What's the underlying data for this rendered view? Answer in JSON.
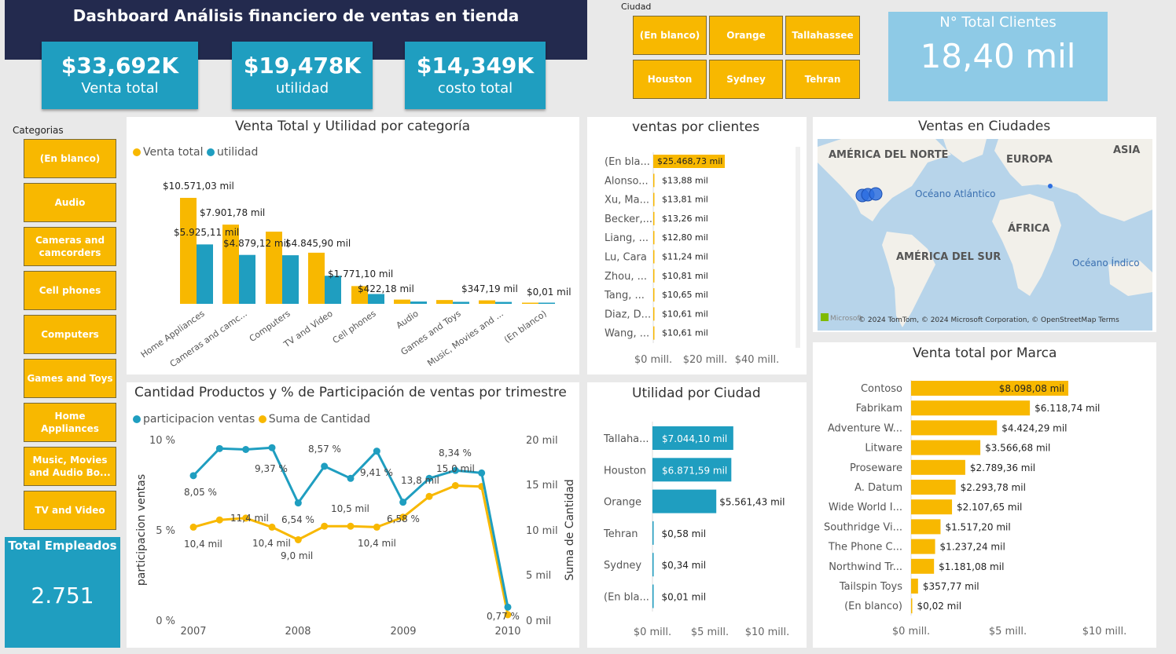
{
  "header": {
    "title": "Dashboard Análisis financiero de ventas en tienda"
  },
  "kpis": [
    {
      "value": "$33,692K",
      "label": "Venta total"
    },
    {
      "value": "$19,478K",
      "label": "utilidad"
    },
    {
      "value": "$14,349K",
      "label": "costo total"
    }
  ],
  "city_slicer": {
    "label": "Ciudad",
    "options": [
      "(En blanco)",
      "Orange",
      "Tallahassee",
      "Houston",
      "Sydney",
      "Tehran"
    ]
  },
  "total_clients": {
    "label": "N° Total Clientes",
    "value": "18,40 mil"
  },
  "category_slicer": {
    "label": "Categorias",
    "options": [
      "(En blanco)",
      "Audio",
      "Cameras and camcorders",
      "Cell phones",
      "Computers",
      "Games and Toys",
      "Home Appliances",
      "Music, Movies and Audio Bo...",
      "TV and Video"
    ]
  },
  "total_employees": {
    "label": "Total Empleados",
    "value": "2.751"
  },
  "colors": {
    "navy": "#232a4e",
    "teal": "#1f9ec0",
    "gold": "#f8b800",
    "light_blue": "#8ecae6"
  },
  "map": {
    "title": "Ventas en Ciudades",
    "labels": [
      "AMÉRICA DEL NORTE",
      "EUROPA",
      "ASIA",
      "Océano Atlántico",
      "ÁFRICA",
      "AMÉRICA DEL SUR",
      "Océano Índico"
    ],
    "attribution": "© 2024 TomTom, © 2024 Microsoft Corporation, © OpenStreetMap Terms",
    "brand": "Microsoft"
  },
  "chart_data": [
    {
      "type": "bar",
      "title": "Venta Total y Utilidad por categoría",
      "categories": [
        "Home Appliances",
        "Cameras and camc...",
        "Computers",
        "TV and Video",
        "Cell phones",
        "Audio",
        "Games and Toys",
        "Music, Movies and ...",
        "(En blanco)"
      ],
      "series": [
        {
          "name": "Venta total",
          "values": [
            10571.03,
            7901.78,
            7200,
            5100,
            1771.1,
            422.18,
            380,
            347.19,
            0.01
          ]
        },
        {
          "name": "utilidad",
          "values": [
            5925.11,
            4879.12,
            4845.9,
            2800,
            980,
            230,
            200,
            190,
            0.01
          ]
        }
      ],
      "data_labels": [
        "$10.571,03 mil",
        "$7.901,78 mil",
        "$5.925,11 mil",
        "$4.879,12 mil",
        "$4.845,90 mil",
        "$1.771,10 mil",
        "$422,18 mil",
        "$347,19 mil",
        "$0,01 mil"
      ]
    },
    {
      "type": "bar",
      "title": "ventas por clientes",
      "categories": [
        "(En bla...",
        "Alonso...",
        "Xu, Ma...",
        "Becker,...",
        "Liang, ...",
        "Lu, Cara",
        "Zhou, ...",
        "Tang, ...",
        "Diaz, D...",
        "Wang, ..."
      ],
      "values": [
        25468.73,
        13.88,
        13.81,
        13.26,
        12.8,
        11.24,
        10.81,
        10.65,
        10.61,
        10.61
      ],
      "labels": [
        "$25.468,73 mil",
        "$13,88 mil",
        "$13,81 mil",
        "$13,26 mil",
        "$12,80 mil",
        "$11,24 mil",
        "$10,81 mil",
        "$10,65 mil",
        "$10,61 mil",
        "$10,61 mil"
      ],
      "xticks": [
        "$0 mill.",
        "$20 mill.",
        "$40 mill."
      ]
    },
    {
      "type": "line",
      "title": "Cantidad Productos y % de Participación de ventas por trimestre",
      "legend": [
        "participacion ventas",
        "Suma de Cantidad"
      ],
      "x_ticks": [
        "2007",
        "2008",
        "2009",
        "2010"
      ],
      "y_left_ticks": [
        "10 %",
        "5 %",
        "0 %"
      ],
      "y_right_ticks": [
        "20 mil",
        "15 mil",
        "10 mil",
        "5 mil",
        "0 mil"
      ],
      "ylabel_left": "participacion ventas",
      "ylabel_right": "Suma de Cantidad",
      "series": [
        {
          "name": "participacion ventas",
          "values": [
            8.05,
            9.55,
            9.5,
            9.6,
            6.54,
            8.57,
            7.9,
            9.41,
            6.58,
            7.9,
            8.34,
            8.2,
            0.77
          ]
        },
        {
          "name": "Suma de Cantidad",
          "values": [
            10.4,
            11.2,
            11.4,
            10.4,
            9.0,
            10.5,
            10.5,
            10.4,
            11.5,
            13.8,
            15.0,
            14.9,
            0.7
          ]
        }
      ],
      "point_labels": [
        "8,05 %",
        "9,37 %",
        "6,54 %",
        "8,57 %",
        "9,41 %",
        "6,58 %",
        "8,34 %",
        "0,77 %",
        "10,4 mil",
        "11,4 mil",
        "10,4 mil",
        "9,0 mil",
        "10,5 mil",
        "10,4 mil",
        "13,8 mil",
        "15,0 mil"
      ]
    },
    {
      "type": "bar",
      "title": "Utilidad por Ciudad",
      "categories": [
        "Tallaha...",
        "Houston",
        "Orange",
        "Tehran",
        "Sydney",
        "(En bla..."
      ],
      "values": [
        7044.1,
        6871.59,
        5561.43,
        0.58,
        0.34,
        0.01
      ],
      "labels": [
        "$7.044,10 mil",
        "$6.871,59 mil",
        "$5.561,43 mil",
        "$0,58 mil",
        "$0,34 mil",
        "$0,01 mil"
      ],
      "xticks": [
        "$0 mill.",
        "$5 mill.",
        "$10 mill."
      ]
    },
    {
      "type": "bar",
      "title": "Venta total por Marca",
      "categories": [
        "Contoso",
        "Fabrikam",
        "Adventure W...",
        "Litware",
        "Proseware",
        "A. Datum",
        "Wide World I...",
        "Southridge Vi...",
        "The Phone C...",
        "Northwind Tr...",
        "Tailspin Toys",
        "(En blanco)"
      ],
      "values": [
        8098.08,
        6118.74,
        4424.29,
        3566.68,
        2789.36,
        2293.78,
        2107.65,
        1517.2,
        1237.24,
        1181.08,
        357.77,
        0.02
      ],
      "labels": [
        "$8.098,08 mil",
        "$6.118,74 mil",
        "$4.424,29 mil",
        "$3.566,68 mil",
        "$2.789,36 mil",
        "$2.293,78 mil",
        "$2.107,65 mil",
        "$1.517,20 mil",
        "$1.237,24 mil",
        "$1.181,08 mil",
        "$357,77 mil",
        "$0,02 mil"
      ],
      "xticks": [
        "$0 mill.",
        "$5 mill.",
        "$10 mill."
      ]
    }
  ]
}
